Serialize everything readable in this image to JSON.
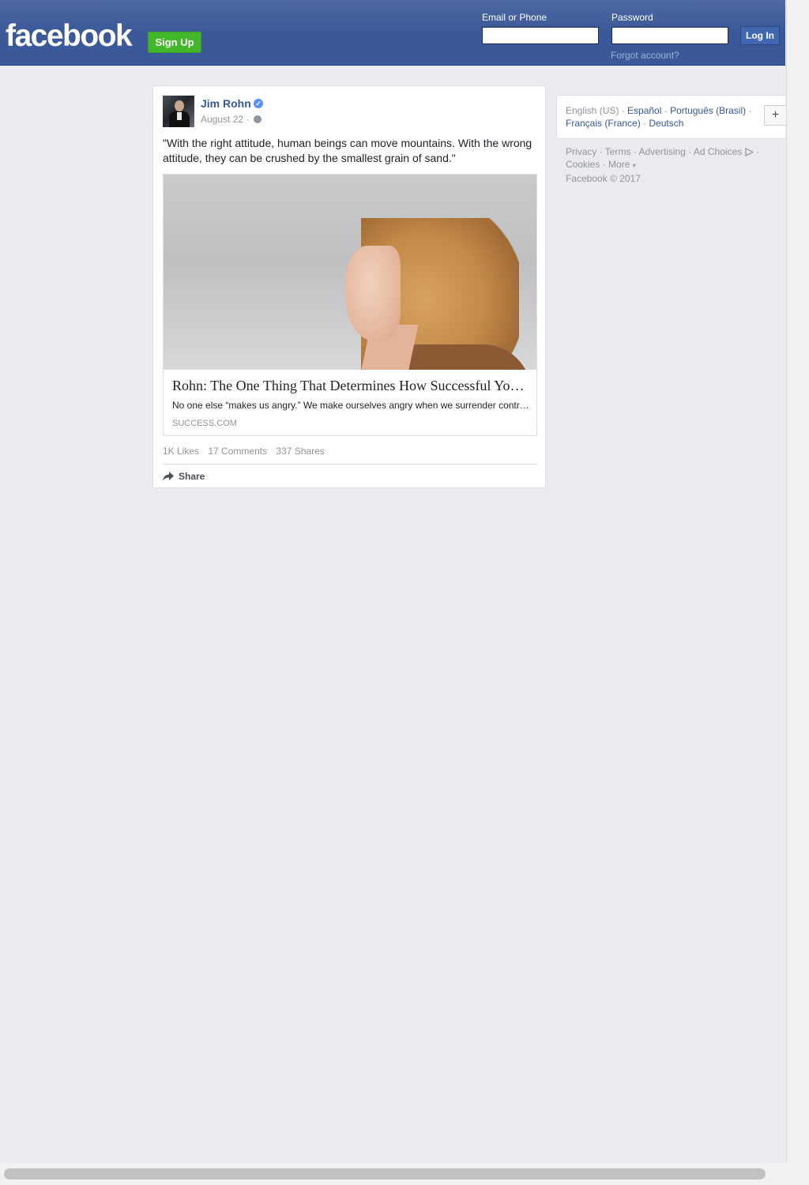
{
  "header": {
    "logo": "facebook",
    "signup_label": "Sign Up",
    "email_label": "Email or Phone",
    "password_label": "Password",
    "email_value": "",
    "password_value": "",
    "login_label": "Log In",
    "forgot_label": "Forgot account?",
    "brand_color": "#3b5998",
    "signup_color": "#42b72a"
  },
  "post": {
    "author": "Jim Rohn",
    "verified_icon": "verified-badge-icon",
    "date": "August 22 ·",
    "privacy_icon": "globe-icon",
    "text": "\"With the right attitude, human beings can move mountains. With the wrong attitude, they can be crushed by the smallest grain of sand.\"",
    "link": {
      "title": "Rohn: The One Thing That Determines How Successful You Are",
      "description": "No one else “makes us angry.” We make ourselves angry when we surrender control of our attitude.",
      "domain": "SUCCESS.COM"
    },
    "stats": {
      "likes": "1K Likes",
      "comments": "17 Comments",
      "shares": "337 Shares"
    },
    "share_label": "Share",
    "share_icon": "share-arrow-icon"
  },
  "sidebar": {
    "languages": [
      {
        "label": "English (US)",
        "active": true
      },
      {
        "label": "Español",
        "active": false
      },
      {
        "label": "Português (Brasil)",
        "active": false
      },
      {
        "label": "Français (France)",
        "active": false
      },
      {
        "label": "Deutsch",
        "active": false
      }
    ],
    "plus_label": "+",
    "footer_links": [
      "Privacy",
      "Terms",
      "Advertising",
      "Ad Choices",
      "Cookies",
      "More"
    ],
    "copyright": "Facebook © 2017"
  }
}
